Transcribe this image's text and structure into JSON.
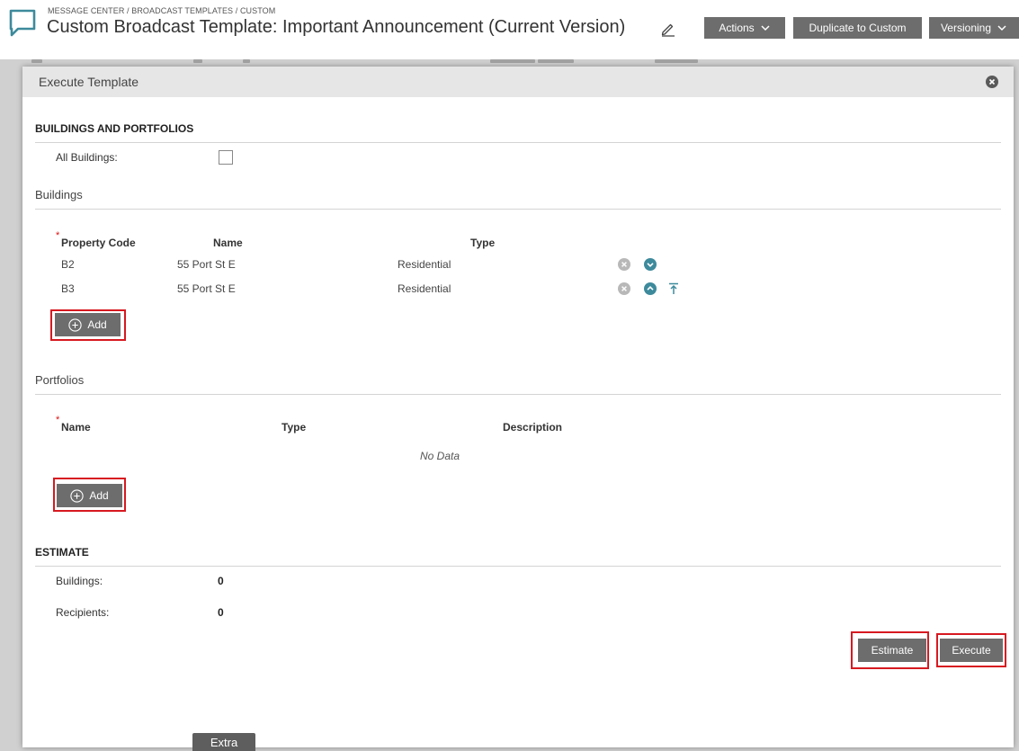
{
  "header": {
    "breadcrumb": "MESSAGE CENTER / BROADCAST TEMPLATES / CUSTOM",
    "title": "Custom Broadcast Template: Important Announcement (Current Version)",
    "buttons": {
      "actions": "Actions",
      "duplicate": "Duplicate to Custom",
      "versioning": "Versioning"
    }
  },
  "modal": {
    "title": "Execute Template",
    "buildings_portfolios": {
      "section_title": "BUILDINGS AND PORTFOLIOS",
      "all_buildings_label": "All Buildings:",
      "all_buildings_checked": false
    },
    "buildings": {
      "title": "Buildings",
      "columns": [
        "Property Code",
        "Name",
        "Type"
      ],
      "rows": [
        {
          "code": "B2",
          "name": "55 Port St E",
          "type": "Residential"
        },
        {
          "code": "B3",
          "name": "55 Port St E",
          "type": "Residential"
        }
      ],
      "add_label": "Add"
    },
    "portfolios": {
      "title": "Portfolios",
      "columns": [
        "Name",
        "Type",
        "Description"
      ],
      "empty_text": "No Data",
      "add_label": "Add"
    },
    "estimate": {
      "section_title": "ESTIMATE",
      "buildings_label": "Buildings:",
      "buildings_value": "0",
      "recipients_label": "Recipients:",
      "recipients_value": "0"
    },
    "footer": {
      "estimate_label": "Estimate",
      "execute_label": "Execute"
    },
    "required_marker": "*"
  },
  "extra_tab": "Extra",
  "colors": {
    "accent": "#3d8a9c",
    "button": "#6d6d6d",
    "highlight": "#d71920",
    "remove_icon": "#b8b8b8"
  }
}
